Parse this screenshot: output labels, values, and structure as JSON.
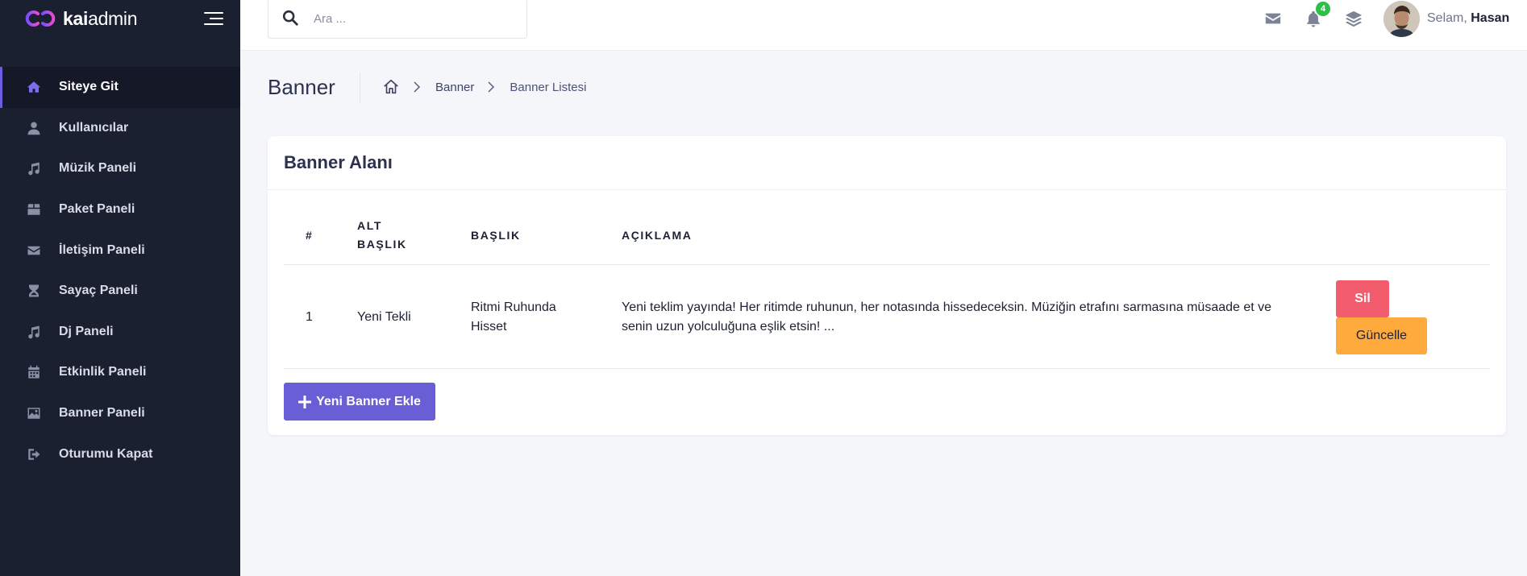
{
  "brand": {
    "logo_bold": "kai",
    "logo_thin": "admin"
  },
  "sidebar": {
    "items": [
      {
        "label": "Siteye Git",
        "icon": "home-icon",
        "active": true
      },
      {
        "label": "Kullanıcılar",
        "icon": "user-icon",
        "active": false
      },
      {
        "label": "Müzik Paneli",
        "icon": "music-icon",
        "active": false
      },
      {
        "label": "Paket Paneli",
        "icon": "box-icon",
        "active": false
      },
      {
        "label": "İletişim Paneli",
        "icon": "envelope-icon",
        "active": false
      },
      {
        "label": "Sayaç Paneli",
        "icon": "hourglass-icon",
        "active": false
      },
      {
        "label": "Dj Paneli",
        "icon": "music-icon",
        "active": false
      },
      {
        "label": "Etkinlik Paneli",
        "icon": "calendar-icon",
        "active": false
      },
      {
        "label": "Banner Paneli",
        "icon": "image-icon",
        "active": false
      },
      {
        "label": "Oturumu Kapat",
        "icon": "sign-out-icon",
        "active": false
      }
    ]
  },
  "topbar": {
    "search_placeholder": "Ara ...",
    "search_value": "",
    "notification_count": "4",
    "greeting_prefix": "Selam, ",
    "user_name": "Hasan"
  },
  "page": {
    "title": "Banner",
    "breadcrumb": [
      "Banner",
      "Banner Listesi"
    ]
  },
  "card": {
    "title": "Banner Alanı",
    "columns": {
      "index": "#",
      "subtitle_line1": "ALT",
      "subtitle_line2": "BAŞLIK",
      "title": "BAŞLIK",
      "description": "AÇIKLAMA"
    },
    "rows": [
      {
        "index": "1",
        "subtitle": "Yeni Tekli",
        "title_line1": "Ritmi Ruhunda",
        "title_line2": "Hisset",
        "description_line1": "Yeni teklim yayında! Her ritimde ruhunun, her notasında hissedeceksin. Müziğin etrafını sarmasına müsaade et ve",
        "description_line2": "senin uzun yolculuğuna eşlik etsin! ...",
        "delete_label": "Sil",
        "update_label": "Güncelle"
      }
    ],
    "add_button_label": "Yeni Banner Ekle"
  },
  "colors": {
    "sidebar_bg": "#1b2031",
    "accent": "#6a5ed6",
    "delete": "#f25c6c",
    "update": "#ffaa3c",
    "badge": "#2fbf48"
  }
}
